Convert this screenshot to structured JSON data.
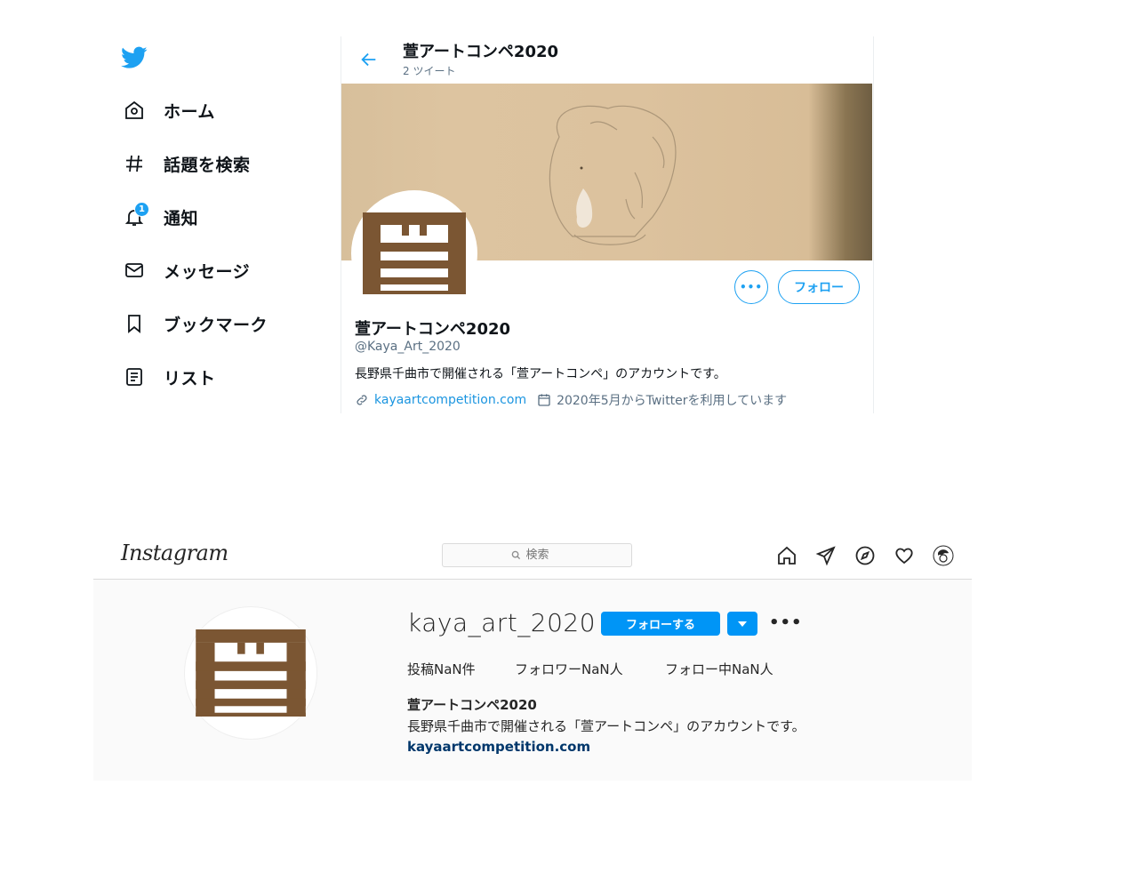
{
  "twitter": {
    "accent": "#1da1f2",
    "nav": [
      {
        "label": "ホーム",
        "icon": "home-icon"
      },
      {
        "label": "話題を検索",
        "icon": "hashtag-icon"
      },
      {
        "label": "通知",
        "icon": "bell-icon",
        "badge": "1"
      },
      {
        "label": "メッセージ",
        "icon": "mail-icon"
      },
      {
        "label": "ブックマーク",
        "icon": "bookmark-icon"
      },
      {
        "label": "リスト",
        "icon": "list-icon"
      }
    ],
    "header": {
      "name": "萱アートコンペ2020",
      "tweet_count": "2 ツイート"
    },
    "profile": {
      "name": "萱アートコンペ2020",
      "handle": "@Kaya_Art_2020",
      "bio": "長野県千曲市で開催される「萱アートコンペ」のアカウントです。",
      "website": "kayaartcompetition.com",
      "joined": "2020年5月からTwitterを利用しています",
      "more_label": "•••",
      "follow_label": "フォロー"
    }
  },
  "instagram": {
    "logo": "Instagram",
    "search_placeholder": "検索",
    "accent": "#0095f6",
    "profile": {
      "username": "kaya_art_2020",
      "follow_label": "フォローする",
      "more_label": "•••",
      "stats": {
        "posts": "投稿NaN件",
        "followers": "フォロワーNaN人",
        "following": "フォロー中NaN人"
      },
      "full_name": "萱アートコンペ2020",
      "bio": "長野県千曲市で開催される「萱アートコンペ」のアカウントです。",
      "website": "kayaartcompetition.com"
    }
  },
  "brand_color": "#7b5633"
}
